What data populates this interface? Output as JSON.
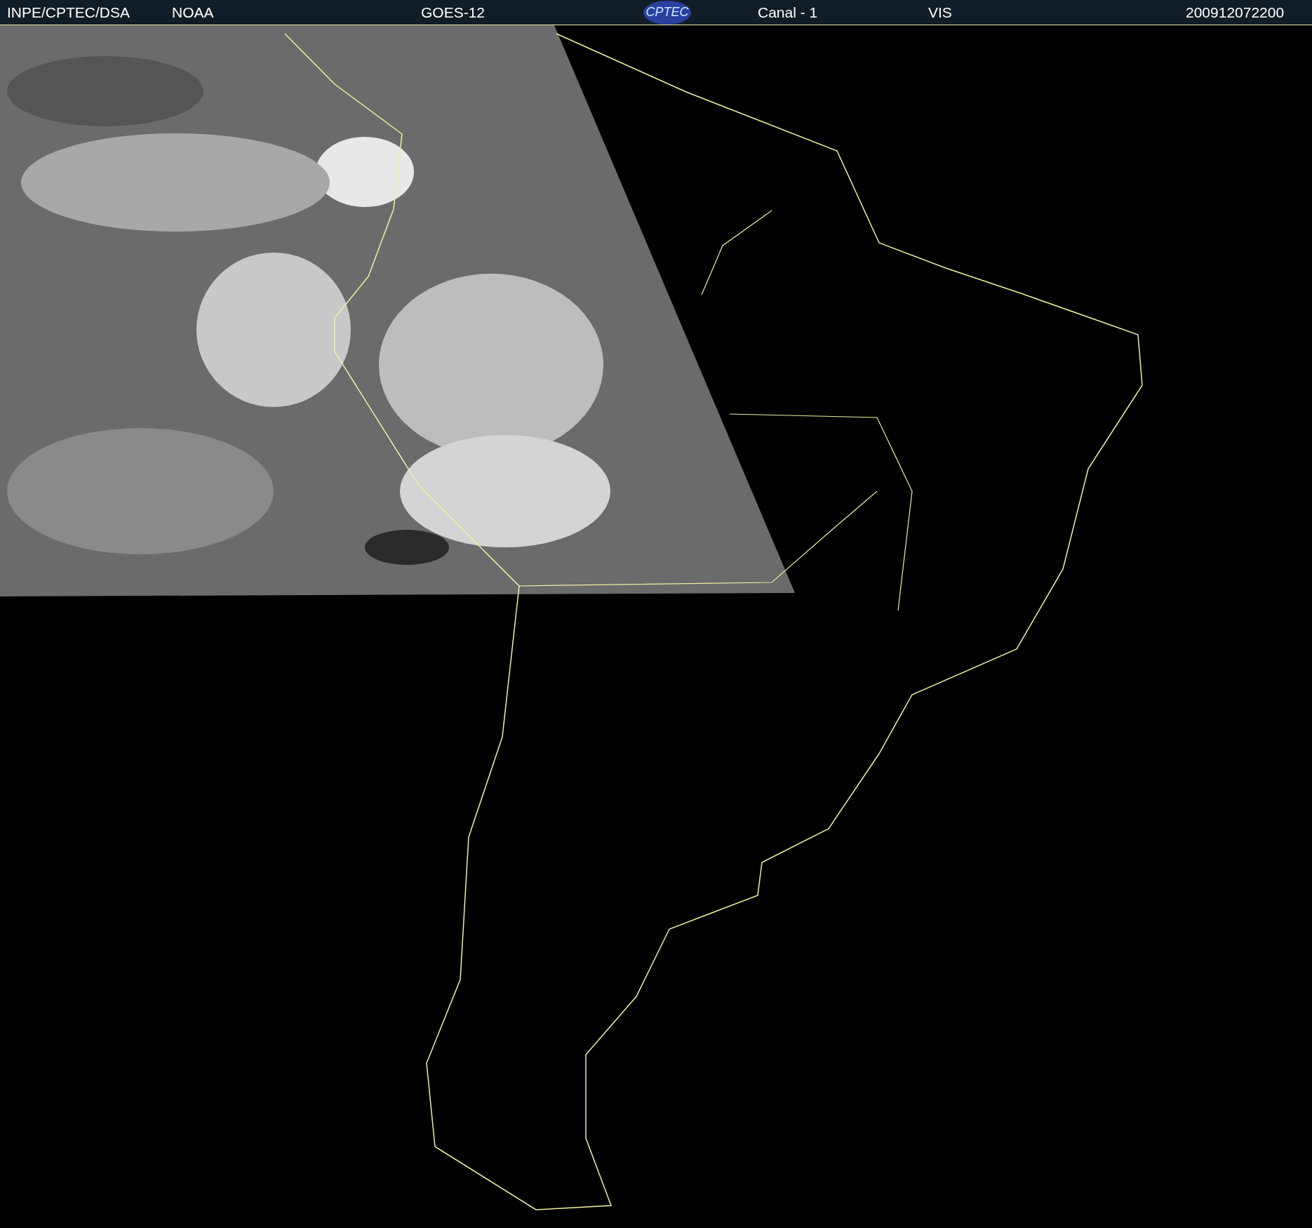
{
  "header": {
    "source": "INPE/CPTEC/DSA",
    "agency": "NOAA",
    "satellite": "GOES-12",
    "logo_text": "CPTEC",
    "channel": "Canal - 1",
    "band": "VIS",
    "timestamp": "200912072200"
  }
}
